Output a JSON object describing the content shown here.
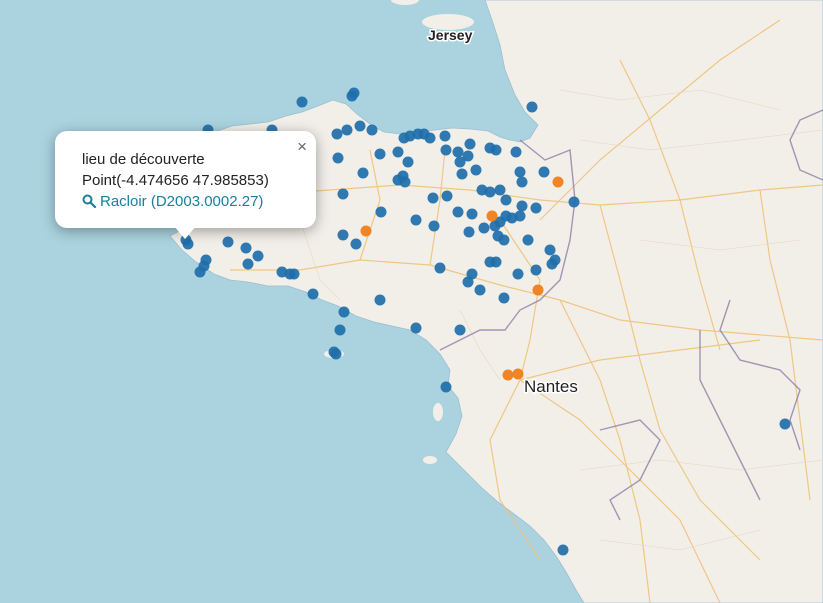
{
  "map": {
    "colors": {
      "sea": "#aad3df",
      "land": "#f2efe9",
      "point_blue": "#1f6faa",
      "point_orange": "#f07d19",
      "road": "#f0c27a",
      "border": "#8c7ea6"
    },
    "labels": {
      "jersey": "Jersey",
      "nantes": "Nantes"
    }
  },
  "popup": {
    "line1": "lieu de découverte",
    "line2": "Point(-4.474656 47.985853)",
    "link": "Racloir (D2003.0002.27)",
    "close": "×"
  }
}
